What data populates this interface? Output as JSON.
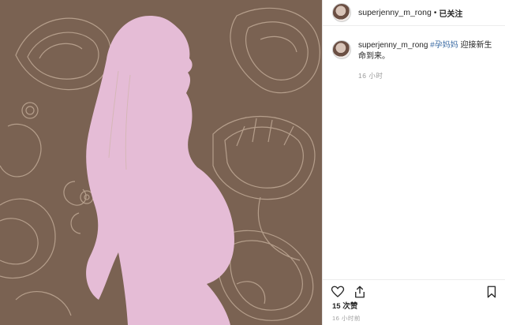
{
  "post": {
    "username": "superjenny_m_rong",
    "separator": "•",
    "follow_label": "已关注",
    "caption_username": "superjenny_m_rong",
    "hashtag": "#孕妈妈",
    "caption_text": " 迎接新生命到来。",
    "caption_time": "16 小时",
    "likes": "15 次赞",
    "post_time": "16 小时前"
  },
  "colors": {
    "background": "#7a6252",
    "silhouette": "#e5bcd6",
    "ornament": "#c9b39f",
    "link": "#3f6ea5"
  },
  "icons": {
    "like": "heart-outline-icon",
    "share": "share-icon",
    "save": "bookmark-icon"
  }
}
